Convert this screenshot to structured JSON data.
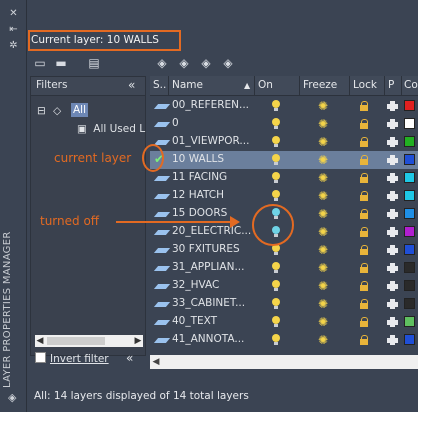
{
  "panel": {
    "side_title": "LAYER PROPERTIES MANAGER",
    "current_layer": "Current layer: 10 WALLS"
  },
  "filters": {
    "header": "Filters",
    "collapse_glyph": "«",
    "tree_all": "All",
    "tree_used": "All Used L",
    "invert_label": "Invert filter",
    "invert_checked": false
  },
  "grid": {
    "columns": [
      "S..",
      "Name",
      "On",
      "Freeze",
      "Lock",
      "P",
      "Co"
    ],
    "rows": [
      {
        "name": "00_REFEREN...",
        "on": true,
        "color": "#e02020"
      },
      {
        "name": "0",
        "on": true,
        "color": "#ffffff"
      },
      {
        "name": "01_VIEWPOR...",
        "on": true,
        "color": "#22b022"
      },
      {
        "name": "10 WALLS",
        "on": true,
        "color": "#1f4fd6",
        "current": true
      },
      {
        "name": "11 FACING",
        "on": true,
        "color": "#1ec8e6"
      },
      {
        "name": "12 HATCH",
        "on": true,
        "color": "#1ec8e6"
      },
      {
        "name": "15 DOORS",
        "on": false,
        "color": "#1f8fe6"
      },
      {
        "name": "20_ELECTRIC...",
        "on": false,
        "color": "#b01fd0"
      },
      {
        "name": "30 FXITURES",
        "on": true,
        "color": "#1f4fd6"
      },
      {
        "name": "31_APPLIAN...",
        "on": true,
        "color": "#2a2a2a"
      },
      {
        "name": "32_HVAC",
        "on": true,
        "color": "#2a2a2a"
      },
      {
        "name": "33_CABINET...",
        "on": true,
        "color": "#2a2a2a"
      },
      {
        "name": "40_TEXT",
        "on": true,
        "color": "#5fc060"
      },
      {
        "name": "41_ANNOTA...",
        "on": true,
        "color": "#1f4fd6"
      }
    ]
  },
  "status": "All: 14 layers displayed of 14 total layers",
  "annotations": {
    "current_layer": "current layer",
    "turned_off": "turned off"
  },
  "colors": {
    "accent": "#e36a22",
    "panel_bg": "#3b4453",
    "bulb_on": "#f4d44a",
    "bulb_off": "#6fd3e6"
  }
}
